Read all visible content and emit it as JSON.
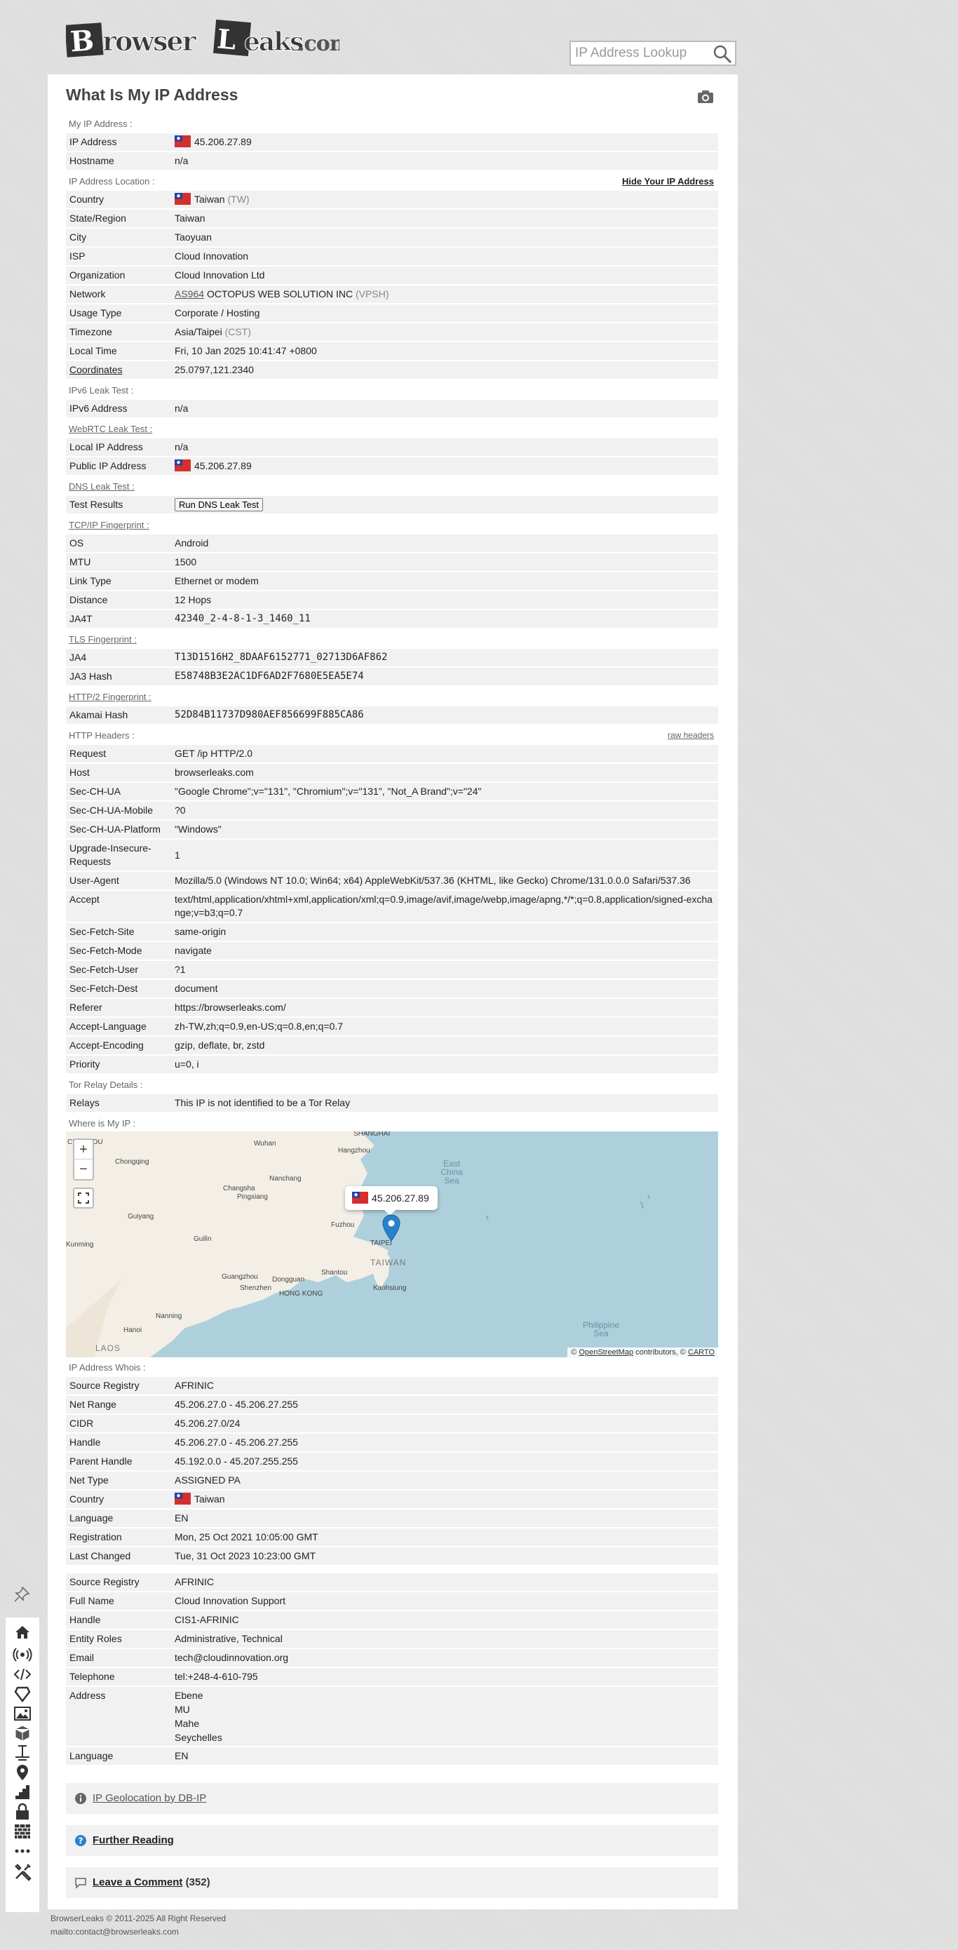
{
  "header": {
    "logo_text": "BrowserLeaks.com",
    "search_placeholder": "IP Address Lookup"
  },
  "page": {
    "title": "What Is My IP Address"
  },
  "sections": {
    "my_ip": {
      "label": "My IP Address :",
      "rows": [
        {
          "k": "IP Address",
          "v": "45.206.27.89"
        },
        {
          "k": "Hostname",
          "v": "n/a"
        }
      ]
    },
    "location": {
      "label": "IP Address Location :",
      "action": "Hide Your IP Address",
      "rows": [
        {
          "k": "Country",
          "v": "Taiwan",
          "extra": "(TW)"
        },
        {
          "k": "State/Region",
          "v": "Taiwan"
        },
        {
          "k": "City",
          "v": "Taoyuan"
        },
        {
          "k": "ISP",
          "v": "Cloud Innovation"
        },
        {
          "k": "Organization",
          "v": "Cloud Innovation Ltd"
        },
        {
          "k": "Network",
          "asn": "AS964",
          "v": "OCTOPUS WEB SOLUTION INC",
          "extra": "(VPSH)"
        },
        {
          "k": "Usage Type",
          "v": "Corporate / Hosting"
        },
        {
          "k": "Timezone",
          "v": "Asia/Taipei",
          "extra": "(CST)"
        },
        {
          "k": "Local Time",
          "v": "Fri, 10 Jan 2025 10:41:47 +0800"
        },
        {
          "k": "Coordinates",
          "v": "25.0797,121.2340"
        }
      ]
    },
    "ipv6": {
      "label": "IPv6 Leak Test :",
      "rows": [
        {
          "k": "IPv6 Address",
          "v": "n/a"
        }
      ]
    },
    "webrtc": {
      "label": "WebRTC Leak Test :",
      "rows": [
        {
          "k": "Local IP Address",
          "v": "n/a"
        },
        {
          "k": "Public IP Address",
          "v": "45.206.27.89"
        }
      ]
    },
    "dns": {
      "label": "DNS Leak Test :",
      "rows": [
        {
          "k": "Test Results",
          "button": "Run DNS Leak Test"
        }
      ]
    },
    "tcpip": {
      "label": "TCP/IP Fingerprint :",
      "rows": [
        {
          "k": "OS",
          "v": "Android"
        },
        {
          "k": "MTU",
          "v": "1500"
        },
        {
          "k": "Link Type",
          "v": "Ethernet or modem"
        },
        {
          "k": "Distance",
          "v": "12 Hops"
        },
        {
          "k": "JA4T",
          "v": "42340_2-4-8-1-3_1460_11"
        }
      ]
    },
    "tls": {
      "label": "TLS Fingerprint :",
      "rows": [
        {
          "k": "JA4",
          "v": "T13D1516H2_8DAAF6152771_02713D6AF862"
        },
        {
          "k": "JA3 Hash",
          "v": "E58748B3E2AC1DF6AD2F7680E5EA5E74"
        }
      ]
    },
    "http2": {
      "label": "HTTP/2 Fingerprint :",
      "rows": [
        {
          "k": "Akamai Hash",
          "v": "52D84B11737D980AEF856699F885CA86"
        }
      ]
    },
    "headers": {
      "label": "HTTP Headers :",
      "action": "raw headers",
      "rows": [
        {
          "k": "Request",
          "v": "GET /ip HTTP/2.0"
        },
        {
          "k": "Host",
          "v": "browserleaks.com"
        },
        {
          "k": "Sec-CH-UA",
          "v": "\"Google Chrome\";v=\"131\", \"Chromium\";v=\"131\", \"Not_A Brand\";v=\"24\""
        },
        {
          "k": "Sec-CH-UA-Mobile",
          "v": "?0"
        },
        {
          "k": "Sec-CH-UA-Platform",
          "v": "\"Windows\""
        },
        {
          "k": "Upgrade-Insecure-Requests",
          "v": "1"
        },
        {
          "k": "User-Agent",
          "v": "Mozilla/5.0 (Windows NT 10.0; Win64; x64) AppleWebKit/537.36 (KHTML, like Gecko) Chrome/131.0.0.0 Safari/537.36"
        },
        {
          "k": "Accept",
          "v": "text/html,application/xhtml+xml,application/xml;q=0.9,image/avif,image/webp,image/apng,*/*;q=0.8,application/signed-exchange;v=b3;q=0.7"
        },
        {
          "k": "Sec-Fetch-Site",
          "v": "same-origin"
        },
        {
          "k": "Sec-Fetch-Mode",
          "v": "navigate"
        },
        {
          "k": "Sec-Fetch-User",
          "v": "?1"
        },
        {
          "k": "Sec-Fetch-Dest",
          "v": "document"
        },
        {
          "k": "Referer",
          "v": "https://browserleaks.com/"
        },
        {
          "k": "Accept-Language",
          "v": "zh-TW,zh;q=0.9,en-US;q=0.8,en;q=0.7"
        },
        {
          "k": "Accept-Encoding",
          "v": "gzip, deflate, br, zstd"
        },
        {
          "k": "Priority",
          "v": "u=0, i"
        }
      ]
    },
    "tor": {
      "label": "Tor Relay Details :",
      "rows": [
        {
          "k": "Relays",
          "v": "This IP is not identified to be a Tor Relay"
        }
      ]
    },
    "map": {
      "label": "Where is My IP :",
      "popup_ip": "45.206.27.89",
      "zoom_in": "+",
      "zoom_out": "−",
      "attribution_prefix": "©",
      "attribution_osm": "OpenStreetMap",
      "attribution_mid": "contributors, ©",
      "attribution_carto": "CARTO",
      "cities": [
        "SHANGHAI",
        "CHENGDU",
        "Wuhan",
        "Hangzhou",
        "Chongqing",
        "Nanchang",
        "Changsha",
        "Pingxiang",
        "Fuzhou",
        "Guiyang",
        "Guilin",
        "Kunming",
        "Guangzhou",
        "Dongguan",
        "Shantou",
        "Shenzhen",
        "HONG KONG",
        "Kaohsiung",
        "Nanning",
        "Hanoi",
        "TAIPEI"
      ],
      "countries": [
        "TAIWAN",
        "LAOS"
      ],
      "seas": [
        "East China Sea",
        "Philippine Sea"
      ]
    },
    "whois": {
      "label": "IP Address Whois :",
      "rows": [
        {
          "k": "Source Registry",
          "v": "AFRINIC"
        },
        {
          "k": "Net Range",
          "v": "45.206.27.0 - 45.206.27.255"
        },
        {
          "k": "CIDR",
          "v": "45.206.27.0/24"
        },
        {
          "k": "Handle",
          "v": "45.206.27.0 - 45.206.27.255"
        },
        {
          "k": "Parent Handle",
          "v": "45.192.0.0 - 45.207.255.255"
        },
        {
          "k": "Net Type",
          "v": "ASSIGNED PA"
        },
        {
          "k": "Country",
          "v": "Taiwan"
        },
        {
          "k": "Language",
          "v": "EN"
        },
        {
          "k": "Registration",
          "v": "Mon, 25 Oct 2021 10:05:00 GMT"
        },
        {
          "k": "Last Changed",
          "v": "Tue, 31 Oct 2023 10:23:00 GMT"
        }
      ],
      "rows2": [
        {
          "k": "Source Registry",
          "v": "AFRINIC"
        },
        {
          "k": "Full Name",
          "v": "Cloud Innovation Support"
        },
        {
          "k": "Handle",
          "v": "CIS1-AFRINIC"
        },
        {
          "k": "Entity Roles",
          "v": "Administrative, Technical"
        },
        {
          "k": "Email",
          "v": "tech@cloudinnovation.org"
        },
        {
          "k": "Telephone",
          "v": "tel:+248-4-610-795"
        },
        {
          "k": "Address",
          "lines": [
            "Ebene",
            "MU",
            "Mahe",
            "Seychelles"
          ]
        },
        {
          "k": "Language",
          "v": "EN"
        }
      ]
    }
  },
  "boxes": {
    "geo": "IP Geolocation by DB-IP",
    "reading": "Further Reading",
    "comment": "Leave a Comment",
    "comment_count": "(352)"
  },
  "footer": {
    "copyright": "BrowserLeaks © 2011-2025 All Right Reserved",
    "contact": "mailto:contact@browserleaks.com"
  },
  "colors": {
    "accent": "#2c7fd3",
    "marker": "#2a81cb",
    "box_bg": "#f1f1f1"
  }
}
